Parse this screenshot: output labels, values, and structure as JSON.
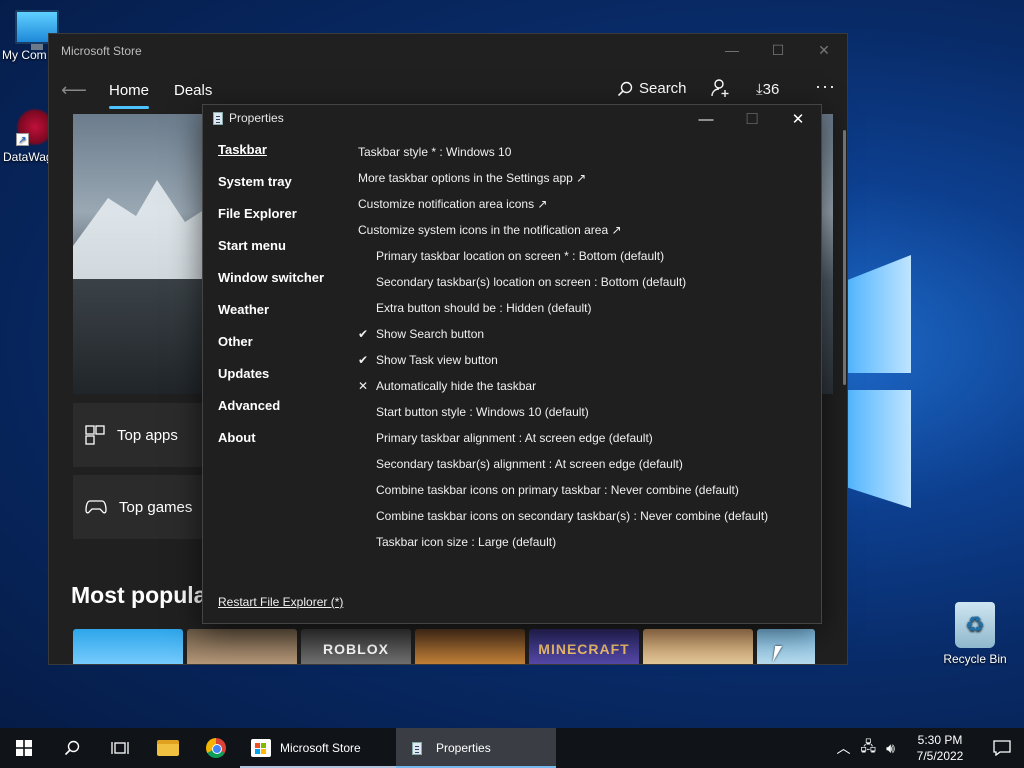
{
  "desktop": {
    "icons": [
      {
        "label": "My Com"
      },
      {
        "label": "DataWag"
      },
      {
        "label": "Recycle Bin"
      }
    ]
  },
  "store": {
    "title": "Microsoft Store",
    "tabs": [
      {
        "label": "Home"
      },
      {
        "label": "Deals"
      }
    ],
    "search_label": "Search",
    "downloads_count": "36",
    "cards": [
      {
        "label": "Top apps"
      },
      {
        "label": "Top games"
      }
    ],
    "section_title": "Most popula",
    "thumbs": [
      "",
      "",
      "ROBLOX",
      "",
      "MINECRAFT",
      "",
      ""
    ]
  },
  "properties": {
    "title": "Properties",
    "nav": [
      {
        "label": "Taskbar",
        "active": true
      },
      {
        "label": "System tray"
      },
      {
        "label": "File Explorer"
      },
      {
        "label": "Start menu"
      },
      {
        "label": "Window switcher"
      },
      {
        "label": "Weather"
      },
      {
        "label": "Other"
      },
      {
        "label": "Updates"
      },
      {
        "label": "Advanced"
      },
      {
        "label": "About"
      }
    ],
    "options": [
      {
        "text": "Taskbar style * : Windows 10",
        "indent": false,
        "mark": ""
      },
      {
        "text": "More taskbar options in the Settings app ↗",
        "indent": false,
        "mark": ""
      },
      {
        "text": "Customize notification area icons ↗",
        "indent": false,
        "mark": ""
      },
      {
        "text": "Customize system icons in the notification area ↗",
        "indent": false,
        "mark": ""
      },
      {
        "text": "Primary taskbar location on screen * : Bottom (default)",
        "indent": true,
        "mark": ""
      },
      {
        "text": "Secondary taskbar(s) location on screen : Bottom (default)",
        "indent": true,
        "mark": ""
      },
      {
        "text": "Extra button should be : Hidden (default)",
        "indent": true,
        "mark": ""
      },
      {
        "text": "Show Search button",
        "indent": true,
        "mark": "✔"
      },
      {
        "text": "Show Task view button",
        "indent": true,
        "mark": "✔"
      },
      {
        "text": "Automatically hide the taskbar",
        "indent": true,
        "mark": "✕"
      },
      {
        "text": "Start button style : Windows 10 (default)",
        "indent": true,
        "mark": ""
      },
      {
        "text": "Primary taskbar alignment : At screen edge (default)",
        "indent": true,
        "mark": ""
      },
      {
        "text": "Secondary taskbar(s) alignment : At screen edge (default)",
        "indent": true,
        "mark": ""
      },
      {
        "text": "Combine taskbar icons on primary taskbar : Never combine (default)",
        "indent": true,
        "mark": ""
      },
      {
        "text": "Combine taskbar icons on secondary taskbar(s) : Never combine (default)",
        "indent": true,
        "mark": ""
      },
      {
        "text": "Taskbar icon size : Large (default)",
        "indent": true,
        "mark": ""
      }
    ],
    "restart_label": "Restart File Explorer (*)"
  },
  "taskbar": {
    "apps": [
      {
        "label": "Microsoft Store"
      },
      {
        "label": "Properties"
      }
    ],
    "time": "5:30 PM",
    "date": "7/5/2022"
  }
}
